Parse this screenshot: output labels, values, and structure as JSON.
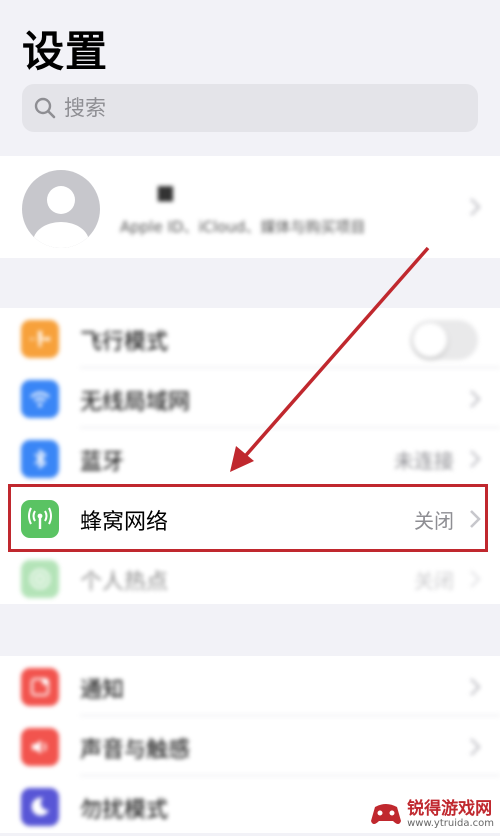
{
  "header": {
    "title": "设置"
  },
  "search": {
    "placeholder": "搜索"
  },
  "profile": {
    "name": "■",
    "subtitle": "Apple ID、iCloud、媒体与购买项目"
  },
  "connectivity": [
    {
      "label": "飞行模式",
      "value": "",
      "icon": "airplane-icon",
      "color": "#f7a13b"
    },
    {
      "label": "无线局域网",
      "value": "",
      "icon": "wifi-icon",
      "color": "#3a86f6"
    },
    {
      "label": "蓝牙",
      "value": "未连接",
      "icon": "bluetooth-icon",
      "color": "#3a86f6"
    },
    {
      "label": "蜂窝网络",
      "value": "关闭",
      "icon": "cellular-icon",
      "color": "#5ac363"
    },
    {
      "label": "个人热点",
      "value": "关闭",
      "icon": "hotspot-icon",
      "color": "#5ac363"
    }
  ],
  "notifications": [
    {
      "label": "通知",
      "icon": "notification-icon",
      "color": "#f2544e"
    },
    {
      "label": "声音与触感",
      "icon": "sound-icon",
      "color": "#f2544e"
    },
    {
      "label": "勿扰模式",
      "icon": "moon-icon",
      "color": "#5856d6"
    }
  ],
  "watermark": {
    "title": "锐得游戏网",
    "url": "www.ytruida.com"
  },
  "colors": {
    "highlight": "#c0282e",
    "background": "#f2f2f7"
  }
}
